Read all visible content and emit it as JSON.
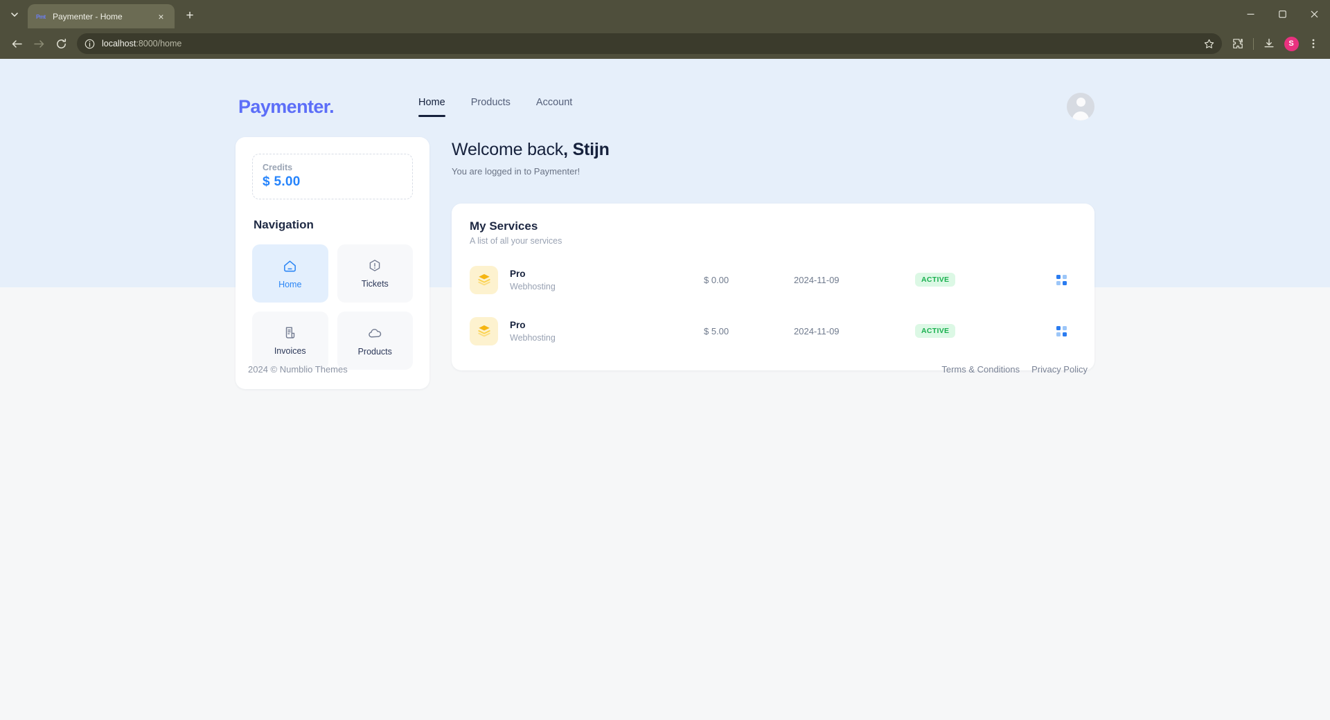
{
  "browser": {
    "tab": {
      "title": "Paymenter - Home",
      "favicon": "paymenter-favicon"
    },
    "new_tab_label": "+",
    "close_label": "×",
    "url_host": "localhost",
    "url_rest": ":8000/home",
    "profile_initial": "S",
    "window": {
      "minimize": "–",
      "maximize": "☐",
      "close": "×"
    }
  },
  "header": {
    "logo": "Paymenter.",
    "nav": [
      {
        "label": "Home",
        "active": true
      },
      {
        "label": "Products",
        "active": false
      },
      {
        "label": "Account",
        "active": false
      }
    ]
  },
  "sidebar": {
    "credits": {
      "label": "Credits",
      "value": "$ 5.00",
      "color": "#2684fc"
    },
    "navigation_heading": "Navigation",
    "nav_cards": [
      {
        "label": "Home",
        "icon": "home-icon",
        "active": true
      },
      {
        "label": "Tickets",
        "icon": "alert-hexagon-icon",
        "active": false
      },
      {
        "label": "Invoices",
        "icon": "invoice-document-icon",
        "active": false
      },
      {
        "label": "Products",
        "icon": "cloud-icon",
        "active": false
      }
    ]
  },
  "main": {
    "welcome_prefix": "Welcome back",
    "welcome_name": ", Stijn",
    "welcome_sub": "You are logged in to Paymenter!",
    "services": {
      "title": "My Services",
      "subtitle": "A list of all your services",
      "rows": [
        {
          "name": "Pro",
          "category": "Webhosting",
          "price": "$ 0.00",
          "date": "2024-11-09",
          "status": "ACTIVE",
          "icon": "layers-stack-icon",
          "action_icon": "grid-menu-icon"
        },
        {
          "name": "Pro",
          "category": "Webhosting",
          "price": "$ 5.00",
          "date": "2024-11-09",
          "status": "ACTIVE",
          "icon": "layers-stack-icon",
          "action_icon": "grid-menu-icon"
        }
      ]
    }
  },
  "footer": {
    "copyright": "2024 ©  Numblio Themes",
    "links": [
      {
        "label": "Terms & Conditions"
      },
      {
        "label": "Privacy Policy"
      }
    ]
  },
  "colors": {
    "brand": "#5c6ef8",
    "accent_blue": "#2684fc",
    "status_green": "#19b04f",
    "hero_bg": "#e6effa"
  }
}
